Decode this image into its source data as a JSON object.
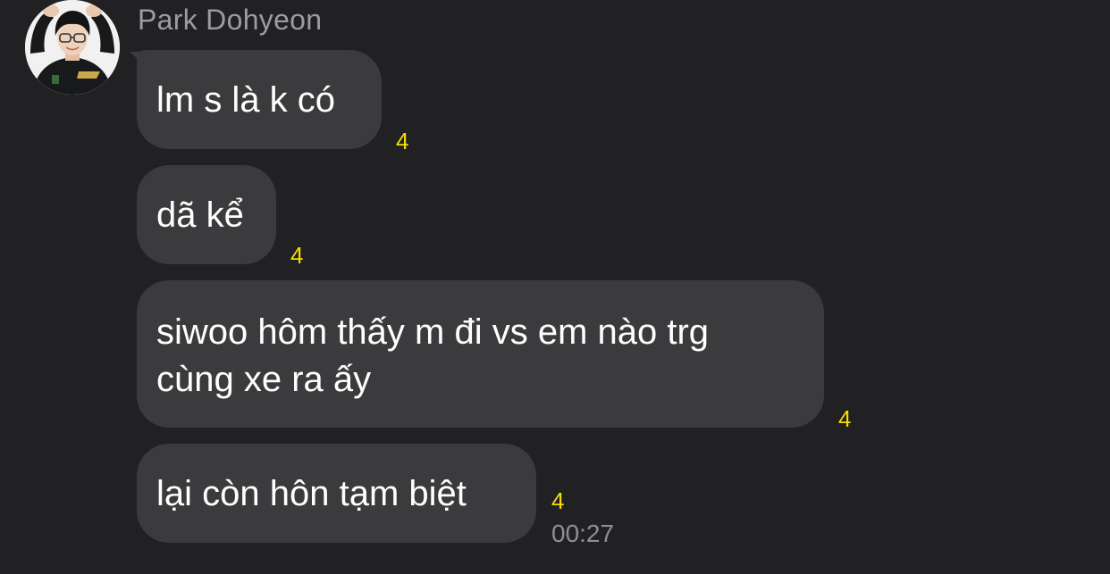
{
  "sender": {
    "name": "Park Dohyeon",
    "avatar": "profile-photo"
  },
  "messages": [
    {
      "text": "lm s là k có",
      "unread": "4"
    },
    {
      "text": "dã kể",
      "unread": "4"
    },
    {
      "lines": [
        "siwoo hôm thấy m đi vs em nào trg",
        "cùng xe ra ấy"
      ],
      "unread": "4"
    },
    {
      "text": "lại còn hôn tạm biệt",
      "unread": "4",
      "time": "00:27"
    }
  ],
  "colors": {
    "background": "#212123",
    "bubble": "#3b3b3d",
    "unread_count": "#f5dd00",
    "secondary_text": "#8f8f93"
  }
}
